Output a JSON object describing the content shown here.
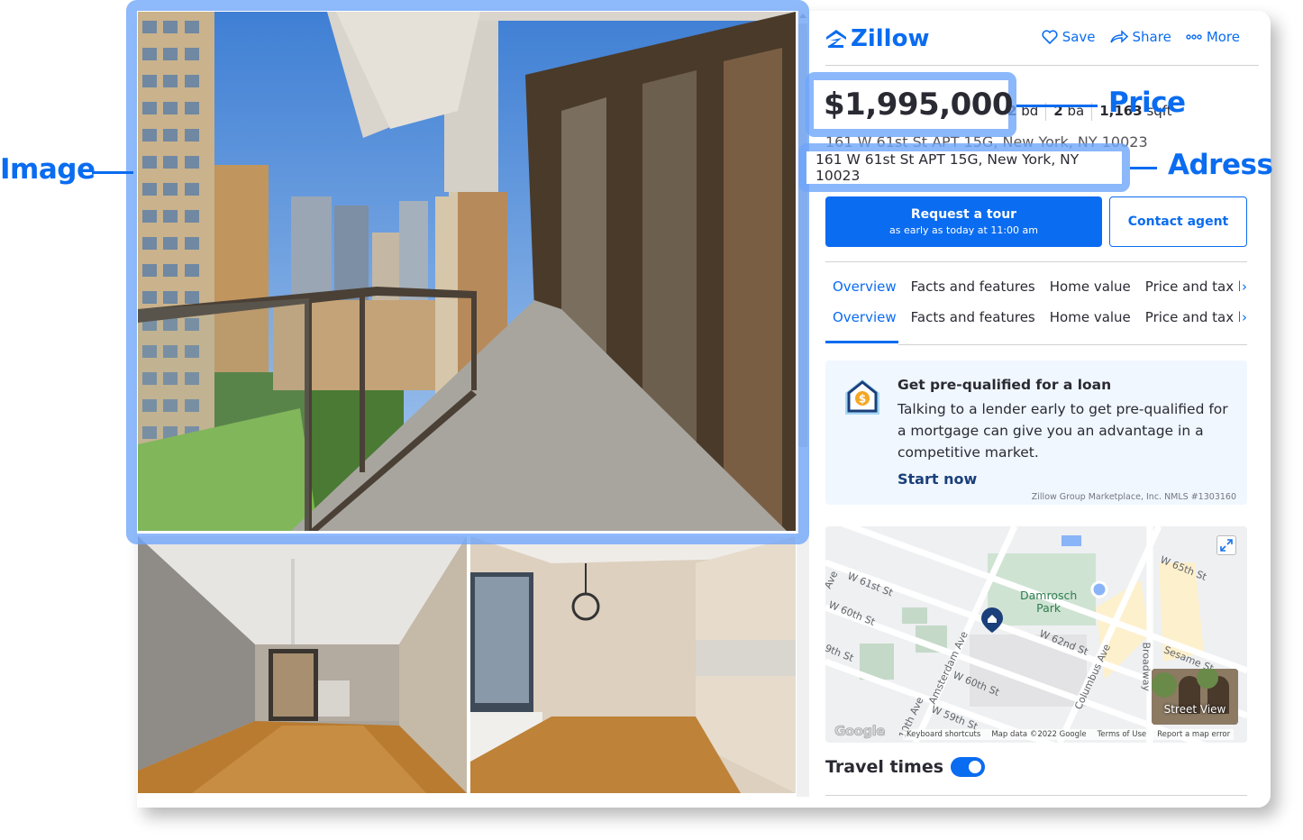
{
  "header": {
    "logo_text": "Zillow",
    "actions": [
      {
        "label": "Save",
        "icon": "heart-icon"
      },
      {
        "label": "Share",
        "icon": "share-icon"
      },
      {
        "label": "More",
        "icon": "more-dots-icon"
      }
    ]
  },
  "listing": {
    "price": "$1,995,000",
    "beds_value": "2",
    "beds_unit": "bd",
    "baths_value": "2",
    "baths_unit": "ba",
    "sqft_value": "1,163",
    "sqft_unit": "sqft",
    "address": "161 W 61st St APT 15G, New York, NY 10023"
  },
  "buttons": {
    "tour_title": "Request a tour",
    "tour_subtitle": "as early as today at 11:00 am",
    "contact": "Contact agent"
  },
  "tabs": [
    {
      "label": "Overview",
      "active": true
    },
    {
      "label": "Facts and features"
    },
    {
      "label": "Home value"
    },
    {
      "label": "Price and tax hist"
    }
  ],
  "loan_card": {
    "title": "Get pre-qualified for a loan",
    "body": "Talking to a lender early to get pre-qualified for a mortgage can give you an advantage in a competitive market.",
    "cta": "Start now",
    "disclaimer": "Zillow Group Marketplace, Inc. NMLS #1303160"
  },
  "map": {
    "park_name_line1": "Damrosch",
    "park_name_line2": "Park",
    "streets": [
      "W 61st St",
      "W 60th St",
      "W 60th St",
      "W 62nd St",
      "W 65th St",
      "W 59th St",
      "Amsterdam Ave",
      "Columbus Ave",
      "Broadway",
      "Sesame St",
      "9th St",
      "Ave",
      "10th Ave"
    ],
    "street_view_label": "Street View",
    "google_logo": "Google",
    "footer_links": [
      "Keyboard shortcuts",
      "Map data ©2022 Google",
      "Terms of Use",
      "Report a map error"
    ]
  },
  "travel_times": {
    "label": "Travel times",
    "enabled": true
  },
  "annotations": {
    "image": "Image",
    "price": "Price",
    "address": "Adress"
  },
  "colors": {
    "brand": "#0a6cf0",
    "highlight": "#6ea5fa",
    "loan_bg": "#f0f7ff"
  }
}
